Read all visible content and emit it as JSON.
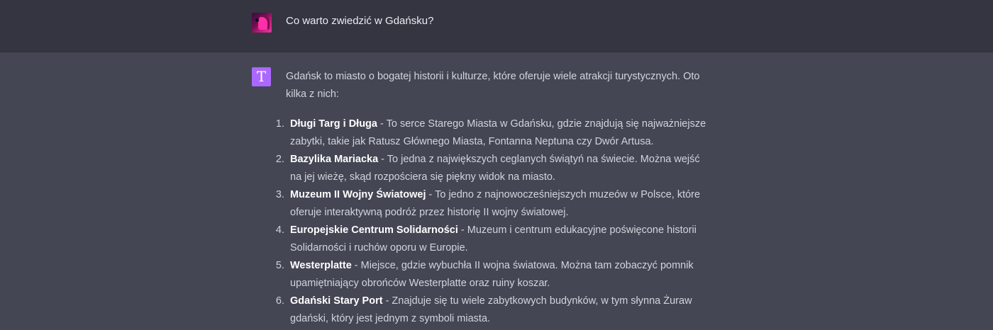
{
  "user_message": {
    "avatar_icon": "user-photo-avatar",
    "text": "Co warto zwiedzić w Gdańsku?"
  },
  "assistant_message": {
    "avatar_letter": "T",
    "avatar_color": "#ab68ff",
    "intro": "Gdańsk to miasto o bogatej historii i kulturze, które oferuje wiele atrakcji turystycznych. Oto kilka z nich:",
    "items": [
      {
        "number": "1.",
        "name": "Długi Targ i Długa",
        "text": " - To serce Starego Miasta w Gdańsku, gdzie znajdują się najważniejsze zabytki, takie jak Ratusz Głównego Miasta, Fontanna Neptuna czy Dwór Artusa."
      },
      {
        "number": "2.",
        "name": "Bazylika Mariacka",
        "text": " - To jedna z największych ceglanych świątyń na świecie. Można wejść na jej wieżę, skąd rozpościera się piękny widok na miasto."
      },
      {
        "number": "3.",
        "name": "Muzeum II Wojny Światowej",
        "text": " - To jedno z najnowocześniejszych muzeów w Polsce, które oferuje interaktywną podróż przez historię II wojny światowej."
      },
      {
        "number": "4.",
        "name": "Europejskie Centrum Solidarności",
        "text": " - Muzeum i centrum edukacyjne poświęcone historii Solidarności i ruchów oporu w Europie."
      },
      {
        "number": "5.",
        "name": "Westerplatte",
        "text": " - Miejsce, gdzie wybuchła II wojna światowa. Można tam zobaczyć pomnik upamiętniający obrońców Westerplatte oraz ruiny koszar."
      },
      {
        "number": "6.",
        "name": "Gdański Stary Port",
        "text": " - Znajduje się tu wiele zabytkowych budynków, w tym słynna Żuraw gdański, który jest jednym z symboli miasta."
      }
    ]
  },
  "colors": {
    "user_bg": "#343541",
    "assistant_bg": "#444654",
    "text": "#d1d5db",
    "bold_text": "#ffffff"
  }
}
